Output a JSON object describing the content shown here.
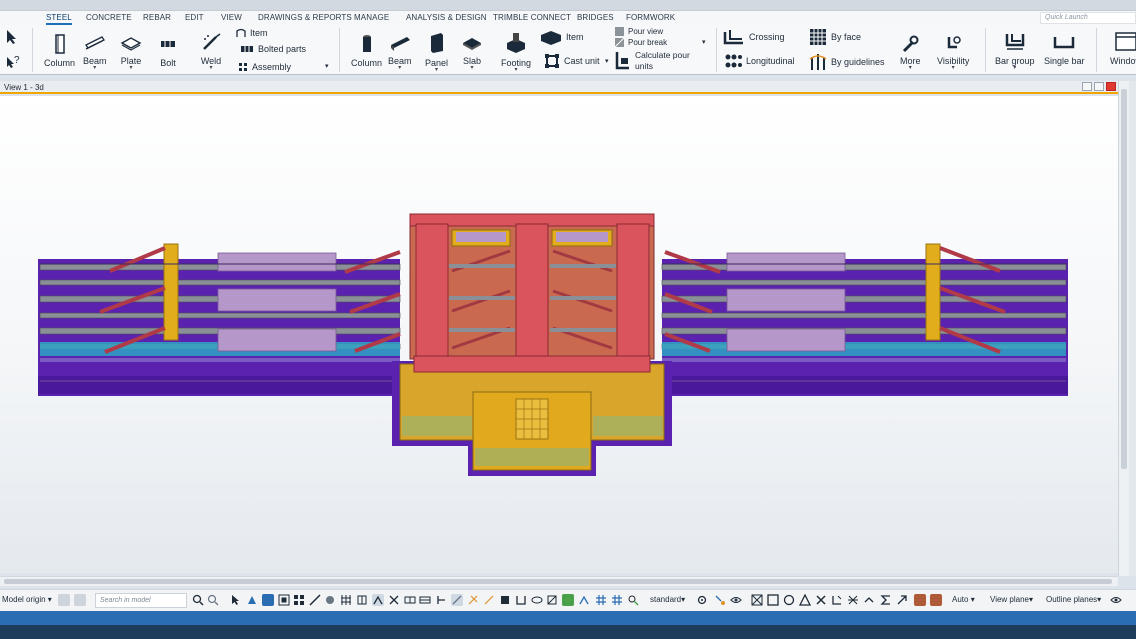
{
  "menu": {
    "tabs": [
      "STEEL",
      "CONCRETE",
      "REBAR",
      "EDIT",
      "VIEW",
      "DRAWINGS & REPORTS",
      "MANAGE",
      "ANALYSIS & DESIGN",
      "TRIMBLE CONNECT",
      "BRIDGES",
      "FORMWORK"
    ],
    "active_tab": "STEEL",
    "quick_launch": "Quick Launch"
  },
  "ribbon": {
    "steel": {
      "column": "Column",
      "beam": "Beam",
      "plate": "Plate",
      "bolt": "Bolt",
      "weld": "Weld",
      "item": "Item",
      "bolted_parts": "Bolted parts",
      "assembly": "Assembly"
    },
    "concrete": {
      "column": "Column",
      "beam": "Beam",
      "panel": "Panel",
      "slab": "Slab",
      "footing": "Footing",
      "item": "Item",
      "cast_unit": "Cast unit",
      "pour_view": "Pour view",
      "pour_break": "Pour break",
      "calculate_pour_units": "Calculate pour units"
    },
    "rebar": {
      "crossing": "Crossing",
      "longitudinal": "Longitudinal",
      "by_face": "By face",
      "by_guidelines": "By guidelines",
      "more": "More",
      "visibility": "Visibility",
      "bar_group": "Bar group",
      "single_bar": "Single bar",
      "window": "Window"
    }
  },
  "view": {
    "title": "View 1 - 3d"
  },
  "statusbar": {
    "model_origin": "Model origin",
    "search_placeholder": "Search in model",
    "standard": "standard",
    "auto": "Auto",
    "view_plane": "View plane",
    "outline_planes": "Outline planes"
  },
  "colors": {
    "accent": "#1c6fb8",
    "view_border": "#f0a600",
    "purple": "#5a1fa8",
    "red": "#d9545c",
    "yellow": "#e2ad1c",
    "teal": "#2ea3c4",
    "lavender": "#a98ac4",
    "taskbar": "#1e3d5c"
  }
}
